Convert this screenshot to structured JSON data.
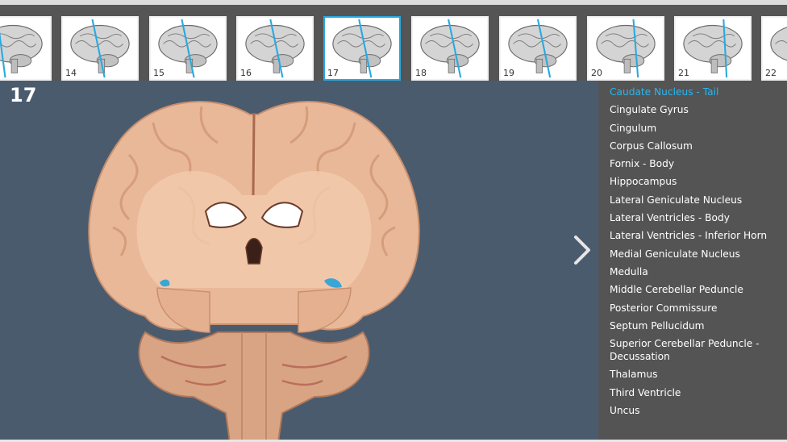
{
  "thumbnails": [
    {
      "num": "",
      "left": 0
    },
    {
      "num": "14"
    },
    {
      "num": "15"
    },
    {
      "num": "16"
    },
    {
      "num": "17"
    },
    {
      "num": "18"
    },
    {
      "num": "19"
    },
    {
      "num": "20"
    },
    {
      "num": "21"
    },
    {
      "num": "22"
    }
  ],
  "active_slice": "17",
  "structures": [
    "Caudate Nucleus - Tail",
    "Cingulate Gyrus",
    "Cingulum",
    "Corpus Callosum",
    "Fornix - Body",
    "Hippocampus",
    "Lateral Geniculate Nucleus",
    "Lateral Ventricles - Body",
    "Lateral Ventricles - Inferior Horn",
    "Medial Geniculate Nucleus",
    "Medulla",
    "Middle Cerebellar Peduncle",
    "Posterior Commissure",
    "Septum Pellucidum",
    "Superior Cerebellar Peduncle - Decussation",
    "Thalamus",
    "Third Ventricle",
    "Uncus"
  ],
  "selected_structure": "Caudate Nucleus - Tail",
  "colors": {
    "accent": "#29b6f0",
    "highlight_region": "#3aa6d6",
    "viewer_bg": "#4b5b6e",
    "sidebar_bg": "#545454"
  },
  "icons": {
    "next": "chevron-right-icon"
  }
}
